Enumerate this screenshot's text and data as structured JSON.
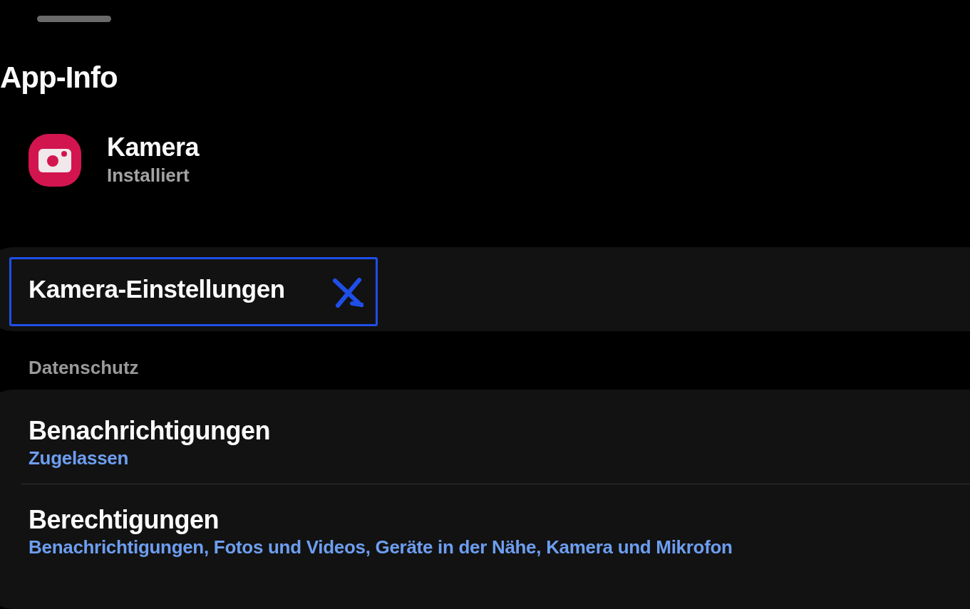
{
  "title": "App-Info",
  "app": {
    "name": "Kamera",
    "status": "Installiert"
  },
  "settings_link": {
    "label": "Kamera-Einstellungen"
  },
  "section": {
    "label": "Datenschutz"
  },
  "items": [
    {
      "title": "Benachrichtigungen",
      "summary": "Zugelassen"
    },
    {
      "title": "Berechtigungen",
      "summary": "Benachrichtigungen, Fotos und Videos, Geräte in der Nähe, Kamera und Mikrofon"
    }
  ]
}
